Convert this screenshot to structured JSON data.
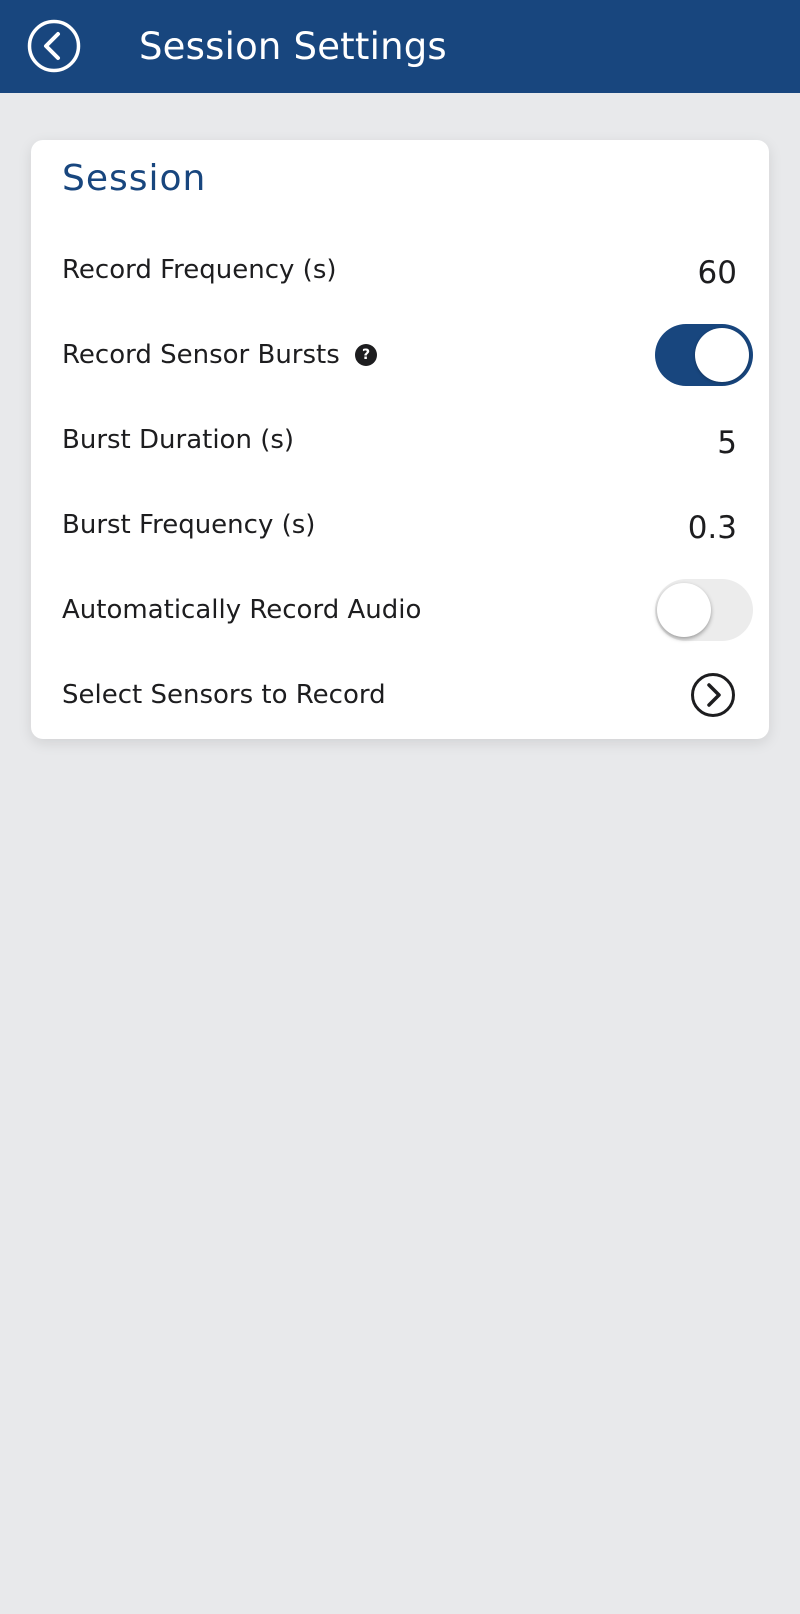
{
  "header": {
    "title": "Session Settings",
    "back_icon": "chevron-left-circle-icon"
  },
  "session": {
    "section_title": "Session",
    "record_frequency": {
      "label": "Record Frequency (s)",
      "value": "60"
    },
    "record_sensor_bursts": {
      "label": "Record Sensor Bursts",
      "help_glyph": "?",
      "enabled": true
    },
    "burst_duration": {
      "label": "Burst Duration (s)",
      "value": "5"
    },
    "burst_frequency": {
      "label": "Burst Frequency (s)",
      "value": "0.3"
    },
    "auto_record_audio": {
      "label": "Automatically Record Audio",
      "enabled": false
    },
    "select_sensors": {
      "label": "Select Sensors to Record",
      "icon": "chevron-right-circle-icon"
    }
  },
  "colors": {
    "primary": "#18467e",
    "background": "#e8e9eb",
    "card": "#ffffff",
    "text": "#1d1d1f"
  }
}
